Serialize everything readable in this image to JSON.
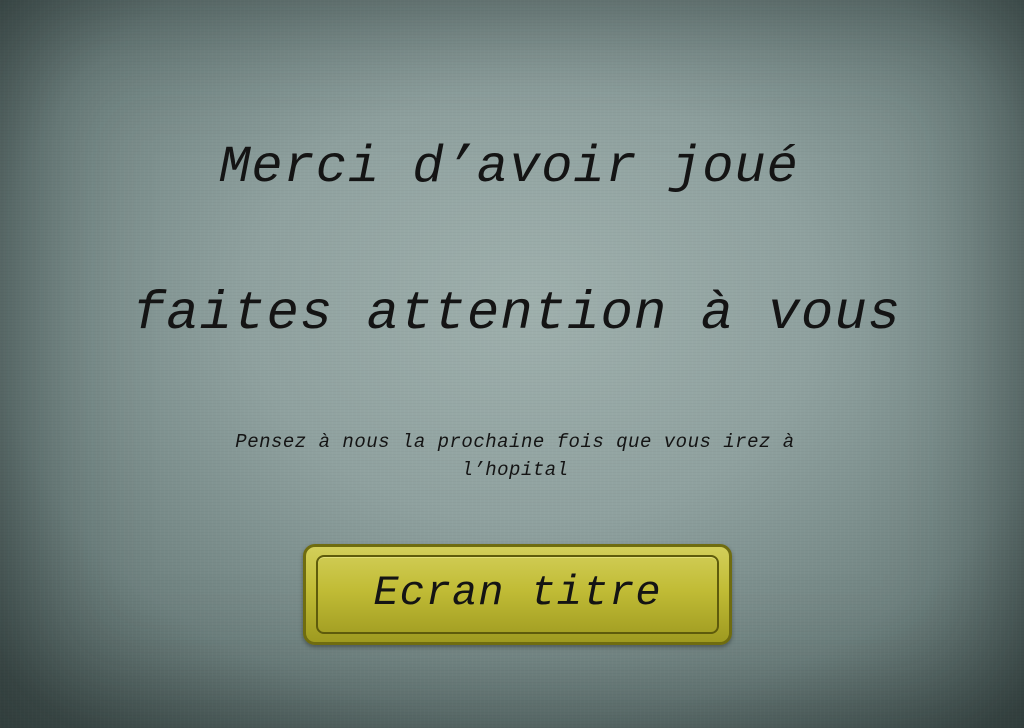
{
  "screen": {
    "heading": "Merci d’avoir joué",
    "warning": "faites attention à vous",
    "message": "Pensez à nous la prochaine fois que vous irez à l’hopital",
    "button_label": "Ecran titre"
  },
  "colors": {
    "background": "#9fb0ad",
    "button_fill": "#c1bc36",
    "button_border": "#6f6c10",
    "text": "#141414"
  }
}
